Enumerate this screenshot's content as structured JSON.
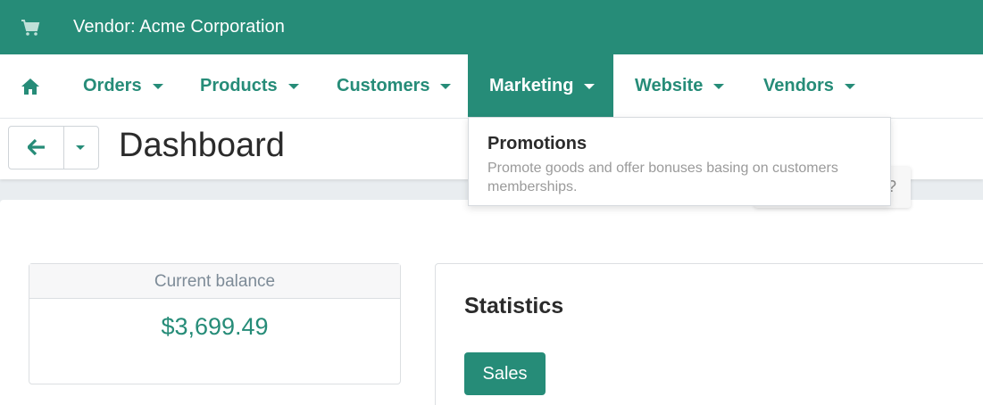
{
  "topbar": {
    "icon": "shopping-cart-icon",
    "vendor_label": "Vendor: Acme Corporation"
  },
  "nav": {
    "home_icon": "home-icon",
    "items": [
      {
        "label": "Orders"
      },
      {
        "label": "Products"
      },
      {
        "label": "Customers"
      },
      {
        "label": "Marketing",
        "active": true
      },
      {
        "label": "Website"
      },
      {
        "label": "Vendors"
      }
    ]
  },
  "dropdown": {
    "items": [
      {
        "title": "Promotions",
        "description": "Promote goods and offer bonuses basing on customers memberships."
      }
    ]
  },
  "header": {
    "title": "Dashboard",
    "back_icon": "arrow-left-icon",
    "menu_icon": "chevron-down-icon"
  },
  "tooltip": {
    "text": "?"
  },
  "balance": {
    "label": "Current balance",
    "value": "$3,699.49"
  },
  "statistics": {
    "title": "Statistics",
    "tabs": [
      {
        "label": "Sales"
      }
    ]
  },
  "colors": {
    "brand": "#268c78",
    "text_dark": "#2b2b2b",
    "muted": "#7d8b97"
  }
}
